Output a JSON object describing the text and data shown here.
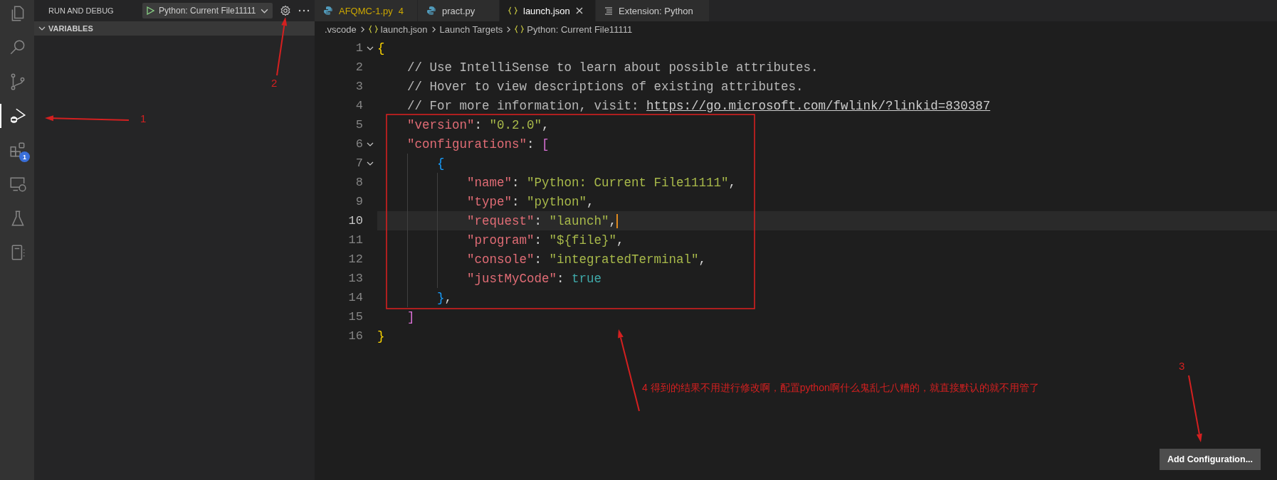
{
  "activity_bar": [
    {
      "kind": "explorer",
      "selected": false
    },
    {
      "kind": "search",
      "selected": false
    },
    {
      "kind": "source-control",
      "selected": false
    },
    {
      "kind": "run",
      "selected": true
    },
    {
      "kind": "extensions",
      "selected": false,
      "badge": "1"
    },
    {
      "kind": "remote",
      "selected": false
    },
    {
      "kind": "testing",
      "selected": false
    },
    {
      "kind": "notebook",
      "selected": false
    }
  ],
  "sidebar": {
    "title": "RUN AND DEBUG",
    "run_config": "Python: Current File11111",
    "section": {
      "title": "VARIABLES",
      "expanded": true
    }
  },
  "tabs": [
    {
      "kind": "python",
      "label": "AFQMC-1.py",
      "badge": "4",
      "warning": true,
      "selected": false
    },
    {
      "kind": "python",
      "label": "pract.py",
      "warning": false,
      "selected": false
    },
    {
      "kind": "json",
      "label": "launch.json",
      "warning": false,
      "selected": true
    },
    {
      "kind": "preview",
      "label": "Extension: Python",
      "warning": false,
      "selected": false
    }
  ],
  "breadcrumb": [
    {
      "kind": "folder",
      "text": ".vscode"
    },
    {
      "kind": "object",
      "text": "launch.json"
    },
    {
      "kind": "folder",
      "text": "Launch Targets"
    },
    {
      "kind": "object",
      "text": "Python: Current File11111"
    }
  ],
  "code": [
    {
      "number": "1",
      "fold": true,
      "current": false,
      "tokens": [
        {
          "kind": "brace",
          "text": "{"
        }
      ]
    },
    {
      "number": "2",
      "fold": false,
      "current": false,
      "tokens": [
        {
          "kind": "comment",
          "text": "// Use IntelliSense to learn about possible attributes."
        }
      ]
    },
    {
      "number": "3",
      "fold": false,
      "current": false,
      "tokens": [
        {
          "kind": "comment",
          "text": "// Hover to view descriptions of existing attributes."
        }
      ]
    },
    {
      "number": "4",
      "fold": false,
      "current": false,
      "tokens": [
        {
          "kind": "comment",
          "text": "// For more information, visit: "
        },
        {
          "kind": "link",
          "text": "https://go.microsoft.com/fwlink/?linkid=830387"
        }
      ]
    },
    {
      "number": "5",
      "fold": false,
      "current": false,
      "tokens": [
        {
          "kind": "key",
          "text": "\"version\""
        },
        {
          "kind": "punct",
          "text": ": "
        },
        {
          "kind": "string",
          "text": "\"0.2.0\""
        },
        {
          "kind": "punct",
          "text": ","
        }
      ]
    },
    {
      "number": "6",
      "fold": true,
      "current": false,
      "tokens": [
        {
          "kind": "key",
          "text": "\"configurations\""
        },
        {
          "kind": "punct",
          "text": ": "
        },
        {
          "kind": "bracket",
          "text": "["
        }
      ]
    },
    {
      "number": "7",
      "fold": true,
      "current": false,
      "tokens": [
        {
          "kind": "inner-brace",
          "text": "{"
        }
      ]
    },
    {
      "number": "8",
      "fold": false,
      "current": false,
      "tokens": [
        {
          "kind": "key",
          "text": "\"name\""
        },
        {
          "kind": "punct",
          "text": ": "
        },
        {
          "kind": "string",
          "text": "\"Python: Current File11111\""
        },
        {
          "kind": "punct",
          "text": ","
        }
      ]
    },
    {
      "number": "9",
      "fold": false,
      "current": false,
      "tokens": [
        {
          "kind": "key",
          "text": "\"type\""
        },
        {
          "kind": "punct",
          "text": ": "
        },
        {
          "kind": "string",
          "text": "\"python\""
        },
        {
          "kind": "punct",
          "text": ","
        }
      ]
    },
    {
      "number": "10",
      "fold": false,
      "current": true,
      "tokens": [
        {
          "kind": "key",
          "text": "\"request\""
        },
        {
          "kind": "punct",
          "text": ": "
        },
        {
          "kind": "string",
          "text": "\"launch\""
        },
        {
          "kind": "punct",
          "text": ","
        }
      ]
    },
    {
      "number": "11",
      "fold": false,
      "current": false,
      "tokens": [
        {
          "kind": "key",
          "text": "\"program\""
        },
        {
          "kind": "punct",
          "text": ": "
        },
        {
          "kind": "string",
          "text": "\"${file}\""
        },
        {
          "kind": "punct",
          "text": ","
        }
      ]
    },
    {
      "number": "12",
      "fold": false,
      "current": false,
      "tokens": [
        {
          "kind": "key",
          "text": "\"console\""
        },
        {
          "kind": "punct",
          "text": ": "
        },
        {
          "kind": "string",
          "text": "\"integratedTerminal\""
        },
        {
          "kind": "punct",
          "text": ","
        }
      ]
    },
    {
      "number": "13",
      "fold": false,
      "current": false,
      "tokens": [
        {
          "kind": "key",
          "text": "\"justMyCode\""
        },
        {
          "kind": "punct",
          "text": ": "
        },
        {
          "kind": "bool",
          "text": "true"
        }
      ]
    },
    {
      "number": "14",
      "fold": false,
      "current": false,
      "tokens": [
        {
          "kind": "inner-brace",
          "text": "}"
        },
        {
          "kind": "punct",
          "text": ","
        }
      ]
    },
    {
      "number": "15",
      "fold": false,
      "current": false,
      "tokens": [
        {
          "kind": "bracket",
          "text": "]"
        }
      ]
    },
    {
      "number": "16",
      "fold": false,
      "current": false,
      "tokens": [
        {
          "kind": "brace",
          "text": "}"
        }
      ]
    }
  ],
  "add_button": "Add Configuration...",
  "annotations": [
    {
      "kind": "callout",
      "text": "1"
    },
    {
      "kind": "callout",
      "text": "2"
    },
    {
      "kind": "callout",
      "text": "3"
    },
    {
      "kind": "note",
      "text": "4  得到的结果不用进行修改啊，配置python啊什么鬼乱七八糟的，就直接默认的就不用管了"
    },
    {
      "kind": "box"
    }
  ]
}
